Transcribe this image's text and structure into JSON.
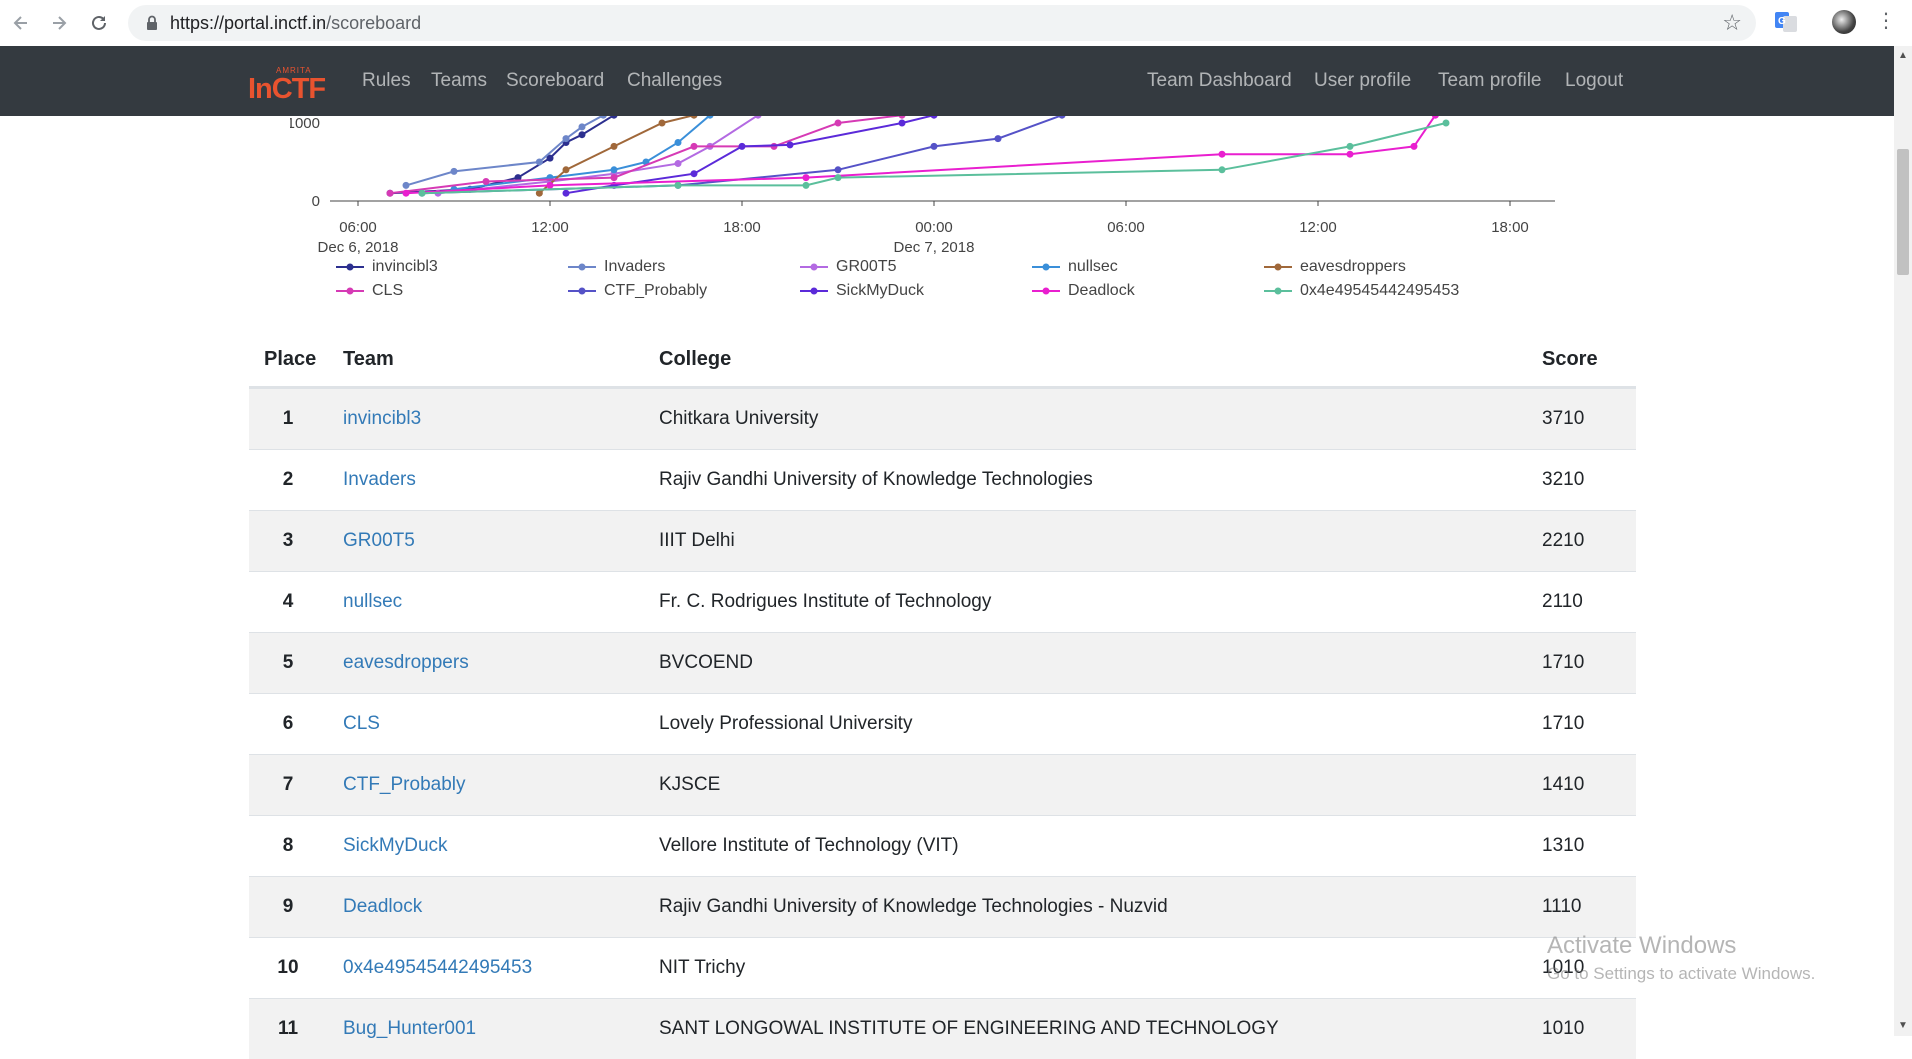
{
  "browser": {
    "url_host": "https://portal.inctf.in",
    "url_path": "/scoreboard",
    "icons": [
      "back-icon",
      "forward-icon",
      "reload-icon",
      "lock-icon",
      "star-icon",
      "translate-icon",
      "avatar",
      "kebab-menu-icon"
    ]
  },
  "nav": {
    "logo_top": "AMRITA",
    "logo_main": "InCTF",
    "left": [
      "Rules",
      "Teams",
      "Scoreboard",
      "Challenges"
    ],
    "right": [
      "Team Dashboard",
      "User profile",
      "Team profile",
      "Logout"
    ]
  },
  "chart_data": {
    "type": "line",
    "ylim": [
      0,
      1000
    ],
    "yticks": [
      "1000",
      "0"
    ],
    "xticks": [
      "06:00",
      "12:00",
      "18:00",
      "00:00",
      "06:00",
      "12:00",
      "18:00"
    ],
    "xsubticks": [
      "Dec 6, 2018",
      "",
      "",
      "Dec 7, 2018",
      "",
      "",
      ""
    ],
    "series": [
      {
        "name": "invincibl3",
        "color": "#2c2f8f",
        "points": [
          [
            "2018-12-06T07:00",
            100
          ],
          [
            "2018-12-06T09:30",
            150
          ],
          [
            "2018-12-06T11:00",
            300
          ],
          [
            "2018-12-06T12:00",
            550
          ],
          [
            "2018-12-06T12:30",
            750
          ],
          [
            "2018-12-06T13:00",
            850
          ],
          [
            "2018-12-06T14:00",
            1100
          ]
        ]
      },
      {
        "name": "Invaders",
        "color": "#6d86c9",
        "points": [
          [
            "2018-12-06T07:30",
            200
          ],
          [
            "2018-12-06T09:00",
            380
          ],
          [
            "2018-12-06T11:40",
            500
          ],
          [
            "2018-12-06T12:30",
            800
          ],
          [
            "2018-12-06T13:00",
            950
          ],
          [
            "2018-12-06T13:40",
            1100
          ]
        ]
      },
      {
        "name": "GR00T5",
        "color": "#b36ae2",
        "points": [
          [
            "2018-12-06T08:30",
            100
          ],
          [
            "2018-12-06T12:00",
            250
          ],
          [
            "2018-12-06T14:00",
            350
          ],
          [
            "2018-12-06T16:00",
            480
          ],
          [
            "2018-12-06T17:00",
            700
          ],
          [
            "2018-12-06T18:30",
            1100
          ]
        ]
      },
      {
        "name": "nullsec",
        "color": "#3a8fd9",
        "points": [
          [
            "2018-12-06T09:00",
            150
          ],
          [
            "2018-12-06T12:00",
            300
          ],
          [
            "2018-12-06T14:00",
            400
          ],
          [
            "2018-12-06T15:00",
            500
          ],
          [
            "2018-12-06T16:00",
            750
          ],
          [
            "2018-12-06T17:00",
            1100
          ]
        ]
      },
      {
        "name": "eavesdroppers",
        "color": "#a0683a",
        "points": [
          [
            "2018-12-06T11:40",
            100
          ],
          [
            "2018-12-06T12:30",
            400
          ],
          [
            "2018-12-06T14:00",
            700
          ],
          [
            "2018-12-06T15:30",
            1000
          ],
          [
            "2018-12-06T16:30",
            1100
          ]
        ]
      },
      {
        "name": "CLS",
        "color": "#d63ab5",
        "points": [
          [
            "2018-12-06T07:00",
            100
          ],
          [
            "2018-12-06T10:00",
            250
          ],
          [
            "2018-12-06T14:00",
            300
          ],
          [
            "2018-12-06T16:30",
            700
          ],
          [
            "2018-12-06T19:00",
            700
          ],
          [
            "2018-12-06T21:00",
            1000
          ],
          [
            "2018-12-06T23:00",
            1100
          ]
        ]
      },
      {
        "name": "CTF_Probably",
        "color": "#5552c7",
        "points": [
          [
            "2018-12-06T08:00",
            100
          ],
          [
            "2018-12-06T16:00",
            200
          ],
          [
            "2018-12-06T21:00",
            400
          ],
          [
            "2018-12-07T00:00",
            700
          ],
          [
            "2018-12-07T02:00",
            800
          ],
          [
            "2018-12-07T04:00",
            1100
          ]
        ]
      },
      {
        "name": "SickMyDuck",
        "color": "#5b2ad9",
        "points": [
          [
            "2018-12-06T12:30",
            100
          ],
          [
            "2018-12-06T14:00",
            200
          ],
          [
            "2018-12-06T16:30",
            350
          ],
          [
            "2018-12-06T18:00",
            700
          ],
          [
            "2018-12-06T19:30",
            720
          ],
          [
            "2018-12-06T23:00",
            1000
          ],
          [
            "2018-12-07T00:00",
            1100
          ]
        ]
      },
      {
        "name": "Deadlock",
        "color": "#e91fcf",
        "points": [
          [
            "2018-12-06T07:30",
            100
          ],
          [
            "2018-12-06T12:00",
            200
          ],
          [
            "2018-12-06T20:00",
            300
          ],
          [
            "2018-12-07T09:00",
            600
          ],
          [
            "2018-12-07T13:00",
            600
          ],
          [
            "2018-12-07T15:00",
            700
          ],
          [
            "2018-12-07T15:40",
            1100
          ]
        ]
      },
      {
        "name": "0x4e49545442495453",
        "color": "#5bbf9c",
        "points": [
          [
            "2018-12-06T08:00",
            100
          ],
          [
            "2018-12-06T16:00",
            200
          ],
          [
            "2018-12-06T20:00",
            200
          ],
          [
            "2018-12-06T21:00",
            300
          ],
          [
            "2018-12-07T09:00",
            400
          ],
          [
            "2018-12-07T13:00",
            700
          ],
          [
            "2018-12-07T16:00",
            1000
          ]
        ]
      }
    ]
  },
  "table": {
    "headers": {
      "place": "Place",
      "team": "Team",
      "college": "College",
      "score": "Score"
    },
    "rows": [
      {
        "place": "1",
        "team": "invincibl3",
        "college": "Chitkara University",
        "score": "3710"
      },
      {
        "place": "2",
        "team": "Invaders",
        "college": "Rajiv Gandhi University of Knowledge Technologies",
        "score": "3210"
      },
      {
        "place": "3",
        "team": "GR00T5",
        "college": "IIIT Delhi",
        "score": "2210"
      },
      {
        "place": "4",
        "team": "nullsec",
        "college": "Fr. C. Rodrigues Institute of Technology",
        "score": "2110"
      },
      {
        "place": "5",
        "team": "eavesdroppers",
        "college": "BVCOEND",
        "score": "1710"
      },
      {
        "place": "6",
        "team": "CLS",
        "college": "Lovely Professional University",
        "score": "1710"
      },
      {
        "place": "7",
        "team": "CTF_Probably",
        "college": "KJSCE",
        "score": "1410"
      },
      {
        "place": "8",
        "team": "SickMyDuck",
        "college": "Vellore Institute of Technology (VIT)",
        "score": "1310"
      },
      {
        "place": "9",
        "team": "Deadlock",
        "college": "Rajiv Gandhi University of Knowledge Technologies - Nuzvid",
        "score": "1110"
      },
      {
        "place": "10",
        "team": "0x4e49545442495453",
        "college": "NIT Trichy",
        "score": "1010"
      },
      {
        "place": "11",
        "team": "Bug_Hunter001",
        "college": "SANT LONGOWAL INSTITUTE OF ENGINEERING AND TECHNOLOGY",
        "score": "1010"
      }
    ]
  },
  "watermark": {
    "line1": "Activate Windows",
    "line2": "Go to Settings to activate Windows."
  }
}
